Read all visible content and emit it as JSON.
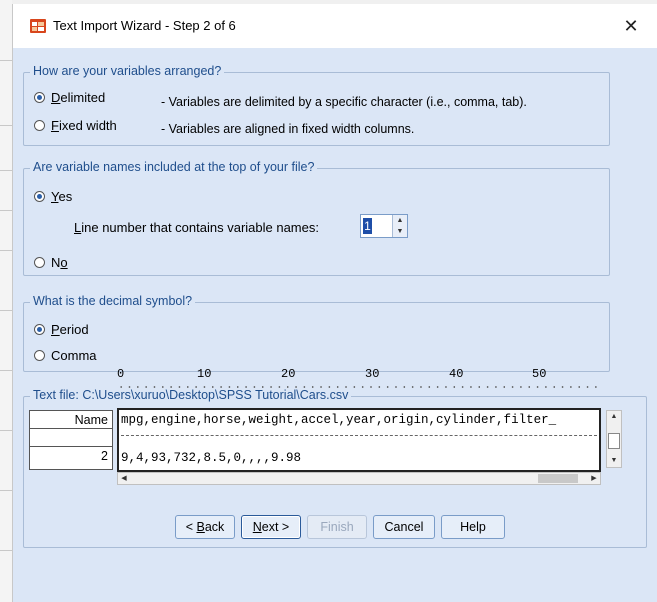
{
  "window": {
    "title": "Text Import Wizard - Step 2 of 6",
    "close_glyph": "✕",
    "icon": "spss-table-icon"
  },
  "arrangement": {
    "legend": "How are your variables arranged?",
    "delimited": {
      "mnemonic": "D",
      "rest": "elimited",
      "desc": "- Variables are delimited by a specific character (i.e., comma, tab).",
      "selected": true
    },
    "fixed": {
      "mnemonic": "F",
      "rest": "ixed width",
      "desc": "- Variables are aligned in fixed width columns.",
      "selected": false
    }
  },
  "varnames": {
    "legend": "Are variable names included at the top of your file?",
    "yes": {
      "mnemonic": "Y",
      "rest": "es",
      "selected": true
    },
    "line_label_mnemonic": "L",
    "line_label_rest": "ine number that contains variable names:",
    "line_value": "1",
    "no": {
      "pre": "N",
      "mnemonic": "o",
      "selected": false
    }
  },
  "decimal": {
    "legend": "What is the decimal symbol?",
    "period": {
      "mnemonic": "P",
      "rest": "eriod",
      "selected": true
    },
    "comma": {
      "label": "Comma",
      "selected": false
    }
  },
  "textfile": {
    "legend": "Text file:  C:\\Users\\xuruo\\Desktop\\SPSS Tutorial\\Cars.csv",
    "ruler": [
      "0",
      "10",
      "20",
      "30",
      "40",
      "50"
    ],
    "row_headers": [
      "Name",
      "",
      "2"
    ],
    "lines": [
      "mpg,engine,horse,weight,accel,year,origin,cylinder,filter_",
      "9,4,93,732,8.5,0,,,,9.98"
    ]
  },
  "buttons": {
    "back_prefix": "< ",
    "back_mnemonic": "B",
    "back_rest": "ack",
    "next_mnemonic": "N",
    "next_rest": "ext >",
    "finish": "Finish",
    "cancel": "Cancel",
    "help": "Help"
  },
  "colors": {
    "client_bg": "#dbe6f6",
    "legend_text": "#1f4e8c",
    "accent": "#2b5fa8"
  }
}
